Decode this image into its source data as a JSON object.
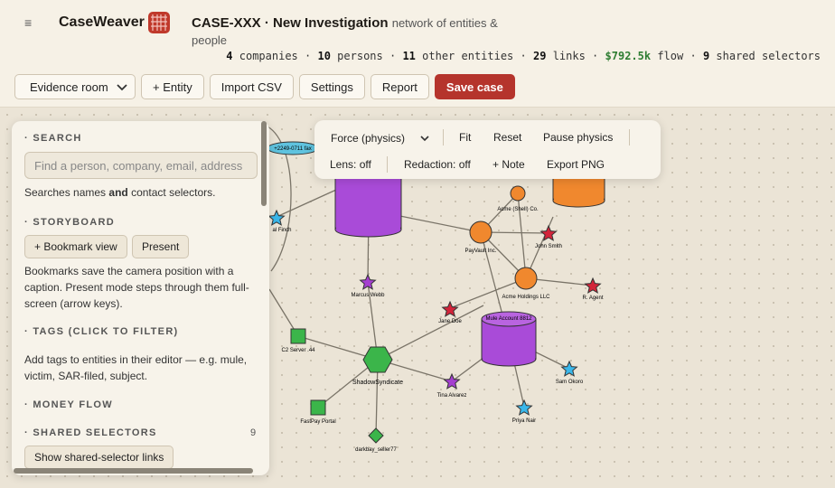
{
  "header": {
    "menu_icon": "≡",
    "brand": "CaseWeaver",
    "case_id": "CASE-XXX · New Investigation",
    "case_subtitle": "network of entities & people",
    "stats": {
      "companies": "4",
      "companies_label": "companies",
      "persons": "10",
      "persons_label": "persons",
      "other": "11",
      "other_label": "other entities",
      "links": "29",
      "links_label": "links",
      "flow": "$792.5k",
      "flow_label": "flow",
      "shared": "9",
      "shared_label": "shared selectors",
      "sep": "·"
    }
  },
  "toolbar": {
    "room_select": "Evidence room",
    "add_entity": "+ Entity",
    "import_csv": "Import CSV",
    "settings": "Settings",
    "report": "Report",
    "save_case": "Save case"
  },
  "sidebar": {
    "search_title": "SEARCH",
    "search_placeholder": "Find a person, company, email, address",
    "search_help_a": "Searches names ",
    "search_help_b": "and",
    "search_help_c": " contact selectors.",
    "storyboard_title": "STORYBOARD",
    "bookmark_btn": "+ Bookmark view",
    "present_btn": "Present",
    "storyboard_help": "Bookmarks save the camera position with a caption. Present mode steps through them full-screen (arrow keys).",
    "tags_title": "TAGS (CLICK TO FILTER)",
    "tags_help": "Add tags to entities in their editor — e.g. mule, victim, SAR-filed, subject.",
    "money_title": "MONEY FLOW",
    "shared_title": "SHARED SELECTORS",
    "shared_count": "9",
    "shared_btn": "Show shared-selector links"
  },
  "graph_controls": {
    "layout_select": "Force (physics)",
    "fit": "Fit",
    "reset": "Reset",
    "pause": "Pause physics",
    "lens": "Lens: off",
    "redaction": "Redaction: off",
    "note": "+ Note",
    "export": "Export PNG"
  },
  "graph": {
    "labels": {
      "top_ellipse": "+2249-0711 fax",
      "acme_shell": "Acme (Shell) Co.",
      "paypal": "PayVault Inc.",
      "john": "John Smith",
      "acme_holdings": "Acme Holdings LLC",
      "agent": "R. Agent",
      "marcus": "Marcus Webb",
      "jane": "Jane Doe",
      "mule": "Mule Account 8812",
      "c2": "C2 Server .44",
      "shadow": "ShadowSyndicate",
      "tina": "Tina Alvarez",
      "sam": "Sam Okoro",
      "priya": "Priya Nair",
      "fastpay": "FastPay Portal",
      "darkbay": "darkbay_seller77",
      "left_finch": "al Finch"
    }
  },
  "colors": {
    "accent": "#b5342c",
    "company": "#f0882e",
    "account": "#a94bd8",
    "group": "#3bb54a",
    "star_red": "#d3243a",
    "star_purple": "#a53fd0",
    "star_blue": "#3ab7ea"
  }
}
